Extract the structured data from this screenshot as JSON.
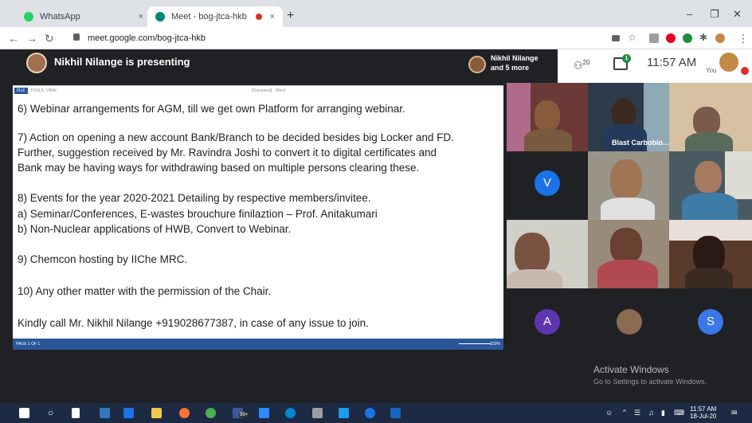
{
  "browser": {
    "tabs": [
      {
        "label": "WhatsApp",
        "active": false,
        "favicon_color": "#25d366"
      },
      {
        "label": "Meet - bog-jtca-hkb",
        "active": true,
        "favicon_color": "#00897b"
      }
    ],
    "url": "meet.google.com/bog-jtca-hkb",
    "new_tab": "+",
    "tab_close": "×"
  },
  "meet": {
    "presenting": "Nikhil Nilange is presenting",
    "presenter_chip": {
      "line1": "Nikhil Nilange",
      "line2": "and 5 more"
    },
    "people_count": "20",
    "chat_badge": "1",
    "time": "11:57 AM",
    "you_label": "You"
  },
  "document": {
    "ribbon": {
      "file": "FILE",
      "tools": "TOOLS",
      "view": "VIEW",
      "title": "[Document] - Word"
    },
    "lines": [
      "6) Webinar arrangements for AGM, till we get own Platform for arranging webinar.",
      "7) Action on opening a new account Bank/Branch to be decided besides big Locker and FD.",
      "Further, suggestion received by Mr. Ravindra Joshi to convert it to digital certificates and",
      "Bank may be having ways for withdrawing based on multiple persons clearing these.",
      " 8) Events for the year 2020-2021 Detailing by respective members/invitee.",
      "a) Seminar/Conferences, E-wastes brouchure finilaztion – Prof. Anitakumari",
      "b) Non-Nuclear applications of HWB, Convert to Webinar.",
      " 9) Chemcon hosting by IIChe MRC.",
      " 10) Any other matter with the permission of the Chair.",
      "Kindly call Mr. Nikhil Nilange +919028677387, in case of any issue to join."
    ],
    "status_left": "PAGE 1 OF 1",
    "status_right": "220%"
  },
  "participants": {
    "blast_name": "Blast Carbobio...",
    "letters": {
      "v": "V",
      "a": "A",
      "s": "S"
    },
    "colors": {
      "v": "#1a73e8",
      "a": "#5e35b1",
      "s": "#3b78e7"
    }
  },
  "activate_windows": {
    "title": "Activate Windows",
    "subtitle": "Go to Settings to activate Windows."
  },
  "taskbar": {
    "time": "11:57 AM",
    "date": "18-Jul-20",
    "badge": "99+"
  }
}
